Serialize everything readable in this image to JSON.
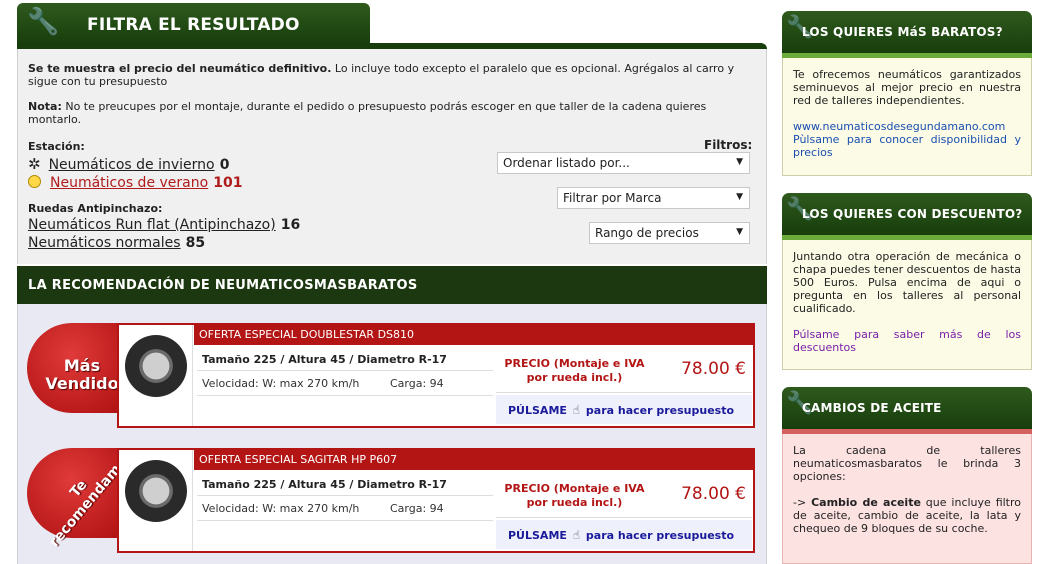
{
  "filter": {
    "title": "FILTRA EL RESULTADO",
    "intro_bold": "Se te muestra el precio del neumático definitivo.",
    "intro_rest": " Lo incluye todo excepto el paralelo que es opcional. Agrégalos al carro y sigue con tu presupuesto",
    "nota_bold": "Nota:",
    "nota_rest": " No te preucupes por el montaje, durante el pedido o presupuesto podrás escoger en que taller de la cadena quieres montarlo.",
    "estacion_label": "Estación:",
    "winter_label": "Neumáticos de invierno",
    "winter_count": "0",
    "summer_label": "Neumáticos de verano",
    "summer_count": "101",
    "runflat_section": "Ruedas Antipinchazo:",
    "runflat_label": "Neumáticos Run flat (Antipinchazo)",
    "runflat_count": "16",
    "normal_label": "Neumáticos normales",
    "normal_count": "85",
    "filtros_label": "Filtros:",
    "order_select": "Ordenar listado por...",
    "brand_select": "Filtrar por Marca",
    "price_select": "Rango de precios"
  },
  "recommendation": {
    "title": "LA RECOMENDACIÓN DE NEUMATICOSMASBARATOS",
    "offers": [
      {
        "badge": "Más Vendido",
        "badge_line1": "Más",
        "badge_line2": "Vendido",
        "heading": "OFERTA ESPECIAL DOUBLESTAR DS810",
        "size": "Tamaño 225 / Altura 45 / Diametro R-17",
        "speed": "Velocidad: W: max 270 km/h",
        "load": "Carga: 94",
        "price_label": "PRECIO (Montaje e IVA por rueda incl.)",
        "price": "78.00 €",
        "quote_bold": "PÚLSAME",
        "quote_rest": "para hacer presupuesto"
      },
      {
        "badge": "Te recomendamos",
        "badge_line1": "Te",
        "badge_line2": "recomendamos",
        "heading": "OFERTA ESPECIAL SAGITAR HP P607",
        "size": "Tamaño 225 / Altura 45 / Diametro R-17",
        "speed": "Velocidad: W: max 270 km/h",
        "load": "Carga: 94",
        "price_label": "PRECIO (Montaje e IVA por rueda incl.)",
        "price": "78.00 €",
        "quote_bold": "PÚLSAME",
        "quote_rest": "para hacer presupuesto"
      }
    ]
  },
  "sidebar": {
    "boxes": [
      {
        "title": "LOS QUIERES MáS BARATOS?",
        "text": "Te ofrecemos neumáticos garantizados seminuevos al mejor precio en nuestra red de talleres independientes.",
        "link_url_text": "www.neumaticosdesegundamano.com",
        "link_text": "Pùlsame para conocer disponibilidad y precios"
      },
      {
        "title": "LOS QUIERES CON DESCUENTO?",
        "text": "Juntando otra operación de mecánica o chapa puedes tener descuentos de hasta 500 Euros. Pulsa encima de aqui o pregunta en los talleres al personal cualificado.",
        "link_text": "Púlsame para saber más de los descuentos"
      },
      {
        "title": "CAMBIOS DE ACEITE",
        "text": "La cadena de talleres neumaticosmasbaratos le brinda 3 opciones:",
        "item_prefix": "-> ",
        "item_bold": "Cambio de aceite",
        "item_rest": " que incluye filtro de aceite, cambio de aceite, la lata y chequeo de 9 bloques de su coche."
      }
    ]
  },
  "colors": {
    "header_green": "#173d0c",
    "offer_red": "#b31515",
    "link_blue": "#1a4fb0",
    "link_purple": "#7a1fa8"
  }
}
